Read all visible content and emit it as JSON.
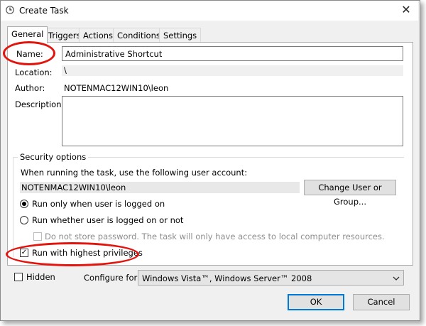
{
  "window": {
    "title": "Create Task",
    "close_glyph": "✕"
  },
  "tabs": [
    {
      "label": "General",
      "active": true
    },
    {
      "label": "Triggers"
    },
    {
      "label": "Actions"
    },
    {
      "label": "Conditions"
    },
    {
      "label": "Settings"
    }
  ],
  "general": {
    "name_label": "Name:",
    "name_value": "Administrative Shortcut",
    "location_label": "Location:",
    "location_value": "\\",
    "author_label": "Author:",
    "author_value": "NOTENMAC12WIN10\\leon",
    "description_label": "Description:",
    "description_value": ""
  },
  "security": {
    "group_label": "Security options",
    "account_prompt": "When running the task, use the following user account:",
    "account_value": "NOTENMAC12WIN10\\leon",
    "change_button": "Change User or Group...",
    "radio_logged_on": "Run only when user is logged on",
    "radio_whether": "Run whether user is logged on or not",
    "no_store_password": "Do not store password.  The task will only have access to local computer resources.",
    "highest_privileges": "Run with highest privileges",
    "highest_privileges_checked": true,
    "selected_radio": "logged_on"
  },
  "footer": {
    "hidden_label": "Hidden",
    "configure_label": "Configure for:",
    "configure_value": "Windows Vista™, Windows Server™ 2008",
    "ok_button": "OK",
    "cancel_button": "Cancel"
  },
  "annotation": {
    "ring_color": "#e3140d"
  }
}
